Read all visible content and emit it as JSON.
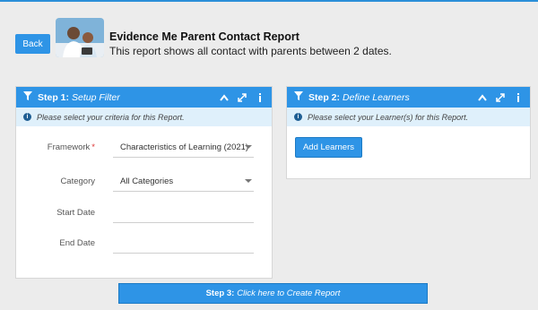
{
  "header": {
    "back_label": "Back",
    "title": "Evidence Me Parent Contact Report",
    "subtitle": "This report shows all contact with parents between 2 dates."
  },
  "step1": {
    "step": "Step 1:",
    "name": "Setup Filter",
    "info": "Please select your criteria for this Report.",
    "fields": [
      {
        "label": "Framework",
        "required": "*",
        "value": "Characteristics of Learning (2021)",
        "type": "select"
      },
      {
        "label": "Category",
        "value": "All Categories",
        "type": "select"
      },
      {
        "label": "Start Date",
        "value": "",
        "type": "date"
      },
      {
        "label": "End Date",
        "value": "",
        "type": "date"
      }
    ]
  },
  "step2": {
    "step": "Step 2:",
    "name": "Define Learners",
    "info": "Please select your Learner(s) for this Report.",
    "add_label": "Add Learners"
  },
  "step3": {
    "step": "Step 3:",
    "name": "Click here to Create Report"
  },
  "icons": {
    "filter": "filter-icon",
    "collapse": "chevron-up-icon",
    "expand": "expand-icon",
    "info": "info-icon"
  },
  "colors": {
    "accent": "#2e94e6",
    "info_bg": "#dff0fb",
    "required": "#dd3333"
  }
}
